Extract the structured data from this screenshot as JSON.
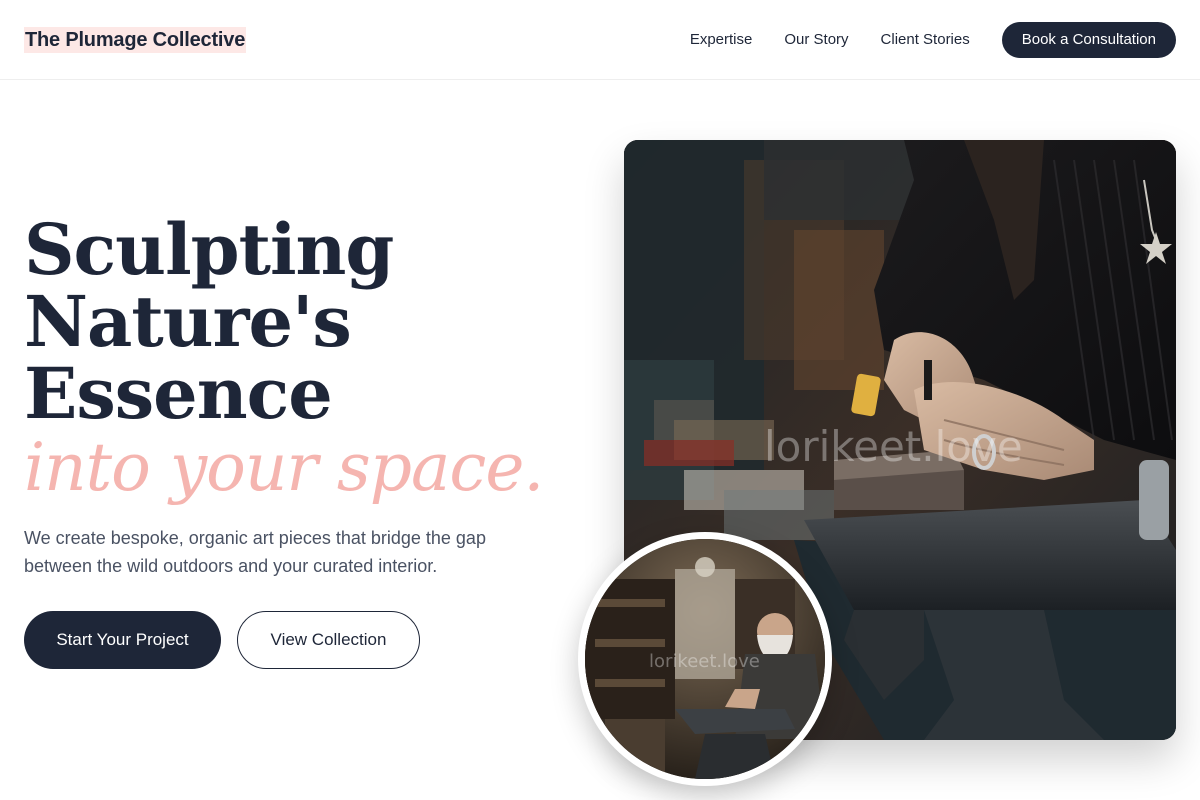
{
  "header": {
    "logo": "The Plumage Collective",
    "nav": [
      "Expertise",
      "Our Story",
      "Client Stories"
    ],
    "cta": "Book a Consultation"
  },
  "hero": {
    "title_lines": [
      "Sculpting",
      "Nature's",
      "Essence"
    ],
    "accent": "into your space.",
    "description": "We create bespoke, organic art pieces that bridge the gap between the wild outdoors and your curated interior.",
    "primary_button": "Start Your Project",
    "secondary_button": "View Collection"
  },
  "images": {
    "main_watermark": "lorikeet.love",
    "inset_watermark": "lorikeet.love"
  },
  "colors": {
    "navy": "#1e2638",
    "accent_pink": "#f5b5b0",
    "logo_highlight": "#fde8e6"
  }
}
